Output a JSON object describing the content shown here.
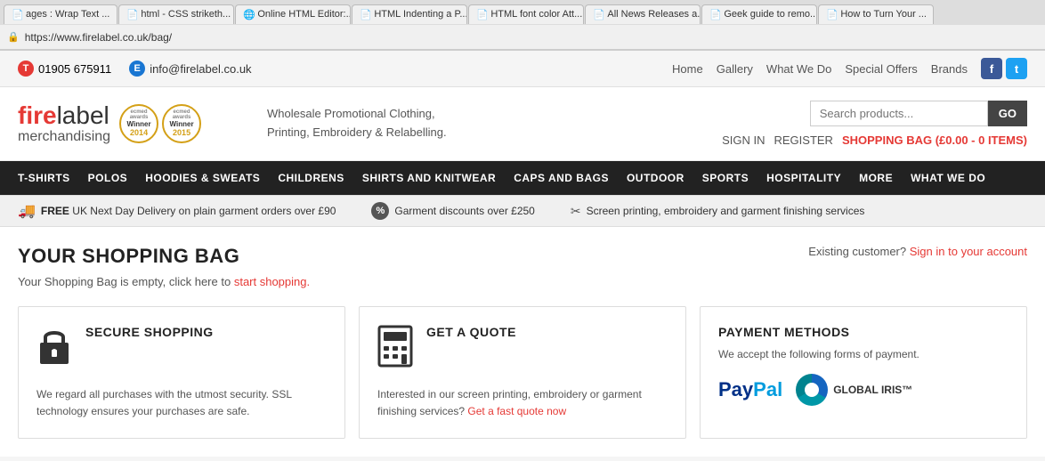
{
  "browser": {
    "url": "https://www.firelabel.co.uk/bag/",
    "tabs": [
      {
        "id": "tab1",
        "label": "ages : Wrap Text ...",
        "icon": "📄",
        "active": false
      },
      {
        "id": "tab2",
        "label": "html - CSS striketh...",
        "icon": "📄",
        "active": false
      },
      {
        "id": "tab3",
        "label": "Online HTML Editor:...",
        "icon": "🌐",
        "active": false
      },
      {
        "id": "tab4",
        "label": "HTML Indenting a P...",
        "icon": "📄",
        "active": false
      },
      {
        "id": "tab5",
        "label": "HTML font color Att...",
        "icon": "📄",
        "active": false
      },
      {
        "id": "tab6",
        "label": "All News Releases a...",
        "icon": "📄",
        "active": false
      },
      {
        "id": "tab7",
        "label": "Geek guide to remo...",
        "icon": "📄",
        "active": false
      },
      {
        "id": "tab8",
        "label": "How to Turn Your ...",
        "icon": "📄",
        "active": false
      }
    ]
  },
  "topbar": {
    "phone": "01905 675911",
    "phone_badge": "T",
    "email": "info@firelabel.co.uk",
    "email_badge": "E",
    "nav": {
      "home": "Home",
      "gallery": "Gallery",
      "what_we_do": "What We Do",
      "special_offers": "Special Offers",
      "brands": "Brands"
    }
  },
  "header": {
    "logo": {
      "fire": "fire",
      "label": "label",
      "merch": "merchandising"
    },
    "award1": {
      "ecmed": "ecmed awards",
      "winner": "Winner",
      "year": "2014"
    },
    "award2": {
      "ecmed": "ecmed awards",
      "winner": "Winner",
      "year": "2015"
    },
    "tagline1": "Wholesale Promotional Clothing,",
    "tagline2": "Printing, Embroidery & Relabelling.",
    "search_placeholder": "Search products...",
    "search_btn": "GO",
    "sign_in": "SIGN IN",
    "register": "REGISTER",
    "shopping_bag": "SHOPPING BAG (£0.00 - 0 ITEMS)"
  },
  "main_nav": {
    "items": [
      "T-SHIRTS",
      "POLOS",
      "HOODIES & SWEATS",
      "CHILDRENS",
      "SHIRTS AND KNITWEAR",
      "CAPS AND BAGS",
      "OUTDOOR",
      "SPORTS",
      "HOSPITALITY",
      "MORE",
      "WHAT WE DO"
    ]
  },
  "info_bar": {
    "item1": "FREE UK Next Day Delivery on plain garment orders over £90",
    "item1_free": "FREE",
    "item2": "Garment discounts over £250",
    "item3": "Screen printing, embroidery and garment finishing services"
  },
  "content": {
    "page_title": "YOUR SHOPPING BAG",
    "existing_label": "Existing customer?",
    "sign_in_link": "Sign in to your account",
    "bag_empty_text": "Your Shopping Bag is empty, click here to",
    "bag_start_link": "start shopping.",
    "cards": {
      "secure": {
        "title": "SECURE SHOPPING",
        "text": "We regard all purchases with the utmost security. SSL technology ensures your purchases are safe."
      },
      "quote": {
        "title": "GET A QUOTE",
        "text": "Interested in our screen printing, embroidery or garment finishing services?",
        "link": "Get a fast quote now"
      },
      "payment": {
        "title": "PAYMENT METHODS",
        "text": "We accept the following forms of payment.",
        "paypal": "PayPal",
        "global_iris": "GLOBAL IRIS™"
      }
    }
  }
}
